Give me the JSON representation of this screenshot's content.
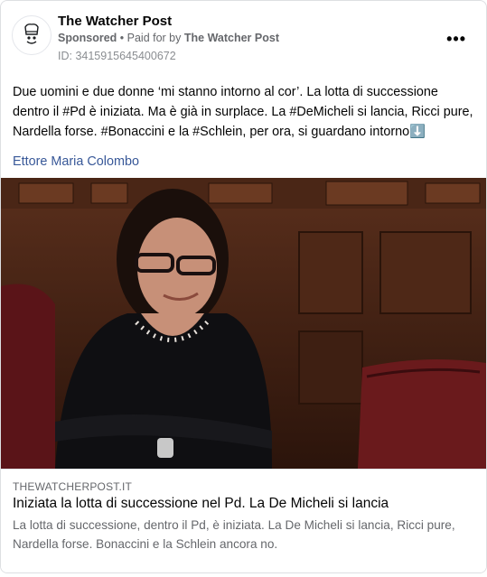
{
  "post": {
    "page_name": "The Watcher Post",
    "sponsored": "Sponsored",
    "paid_for_prefix": "• Paid for by",
    "paid_for_name": "The Watcher Post",
    "ad_id": "ID: 3415915645400672",
    "more_label": "•••",
    "text": "Due uomini e due donne ‘mi stanno intorno al cor’. La lotta di successione dentro il #Pd è iniziata. Ma è già in surplace. La #DeMicheli si lancia, Ricci pure, Nardella forse. #Bonaccini e la #Schlein, per ora, si guardano intorno⬇️",
    "author": "Ettore Maria Colombo"
  },
  "link": {
    "domain": "THEWATCHERPOST.IT",
    "title": "Iniziata la lotta di successione nel Pd. La De Micheli si lancia",
    "description": "La lotta di successione, dentro il Pd, è iniziata. La De Micheli si lancia, Ricci pure, Nardella forse. Bonaccini e la Schlein ancora no."
  },
  "colors": {
    "author_link": "#385898",
    "meta_text": "#65676b"
  }
}
